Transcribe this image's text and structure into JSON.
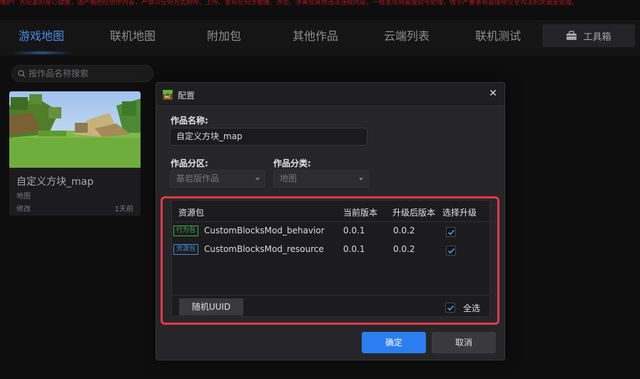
{
  "banner": {
    "text": "维护广大玩家的身心健康，请严格把控创作内容，严禁以任何方式制作、上传、发布任何涉歌赌、涉恐、涉黄及其他违法违规内容，一经发现将直接封号处理，情节严重者将直接移交至司法机关调查处理。"
  },
  "nav": {
    "tabs": [
      "游戏地图",
      "联机地图",
      "附加包",
      "其他作品",
      "云端列表",
      "联机测试"
    ],
    "active_tab": "游戏地图",
    "toolbox_label": "工具箱"
  },
  "search": {
    "placeholder": "按作品名称搜索"
  },
  "card": {
    "title": "自定义方块_map",
    "type": "地图",
    "status": "修改",
    "time": "1天前"
  },
  "dialog": {
    "title": "配置",
    "name_label": "作品名称:",
    "name_value": "自定义方块_map",
    "zone_label": "作品分区:",
    "zone_value": "基岩版作品",
    "category_label": "作品分类:",
    "category_value": "地图",
    "table": {
      "headers": [
        "资源包",
        "当前版本",
        "升级后版本",
        "选择升级"
      ],
      "rows": [
        {
          "badge": "行为包",
          "badge_color": "#3fb14b",
          "name": "CustomBlocksMod_behavior",
          "current": "0.0.1",
          "upgraded": "0.0.2",
          "selected": true
        },
        {
          "badge": "资源包",
          "badge_color": "#4a88d4",
          "name": "CustomBlocksMod_resource",
          "current": "0.0.1",
          "upgraded": "0.0.2",
          "selected": true
        }
      ],
      "uuid_button": "随机UUID",
      "select_all_label": "全选",
      "select_all": true
    },
    "ok_button": "确定",
    "cancel_button": "取消"
  },
  "colors": {
    "accent": "#2b7ef0",
    "active_tab": "#4b8fe5",
    "highlight_border": "#e8384a"
  }
}
